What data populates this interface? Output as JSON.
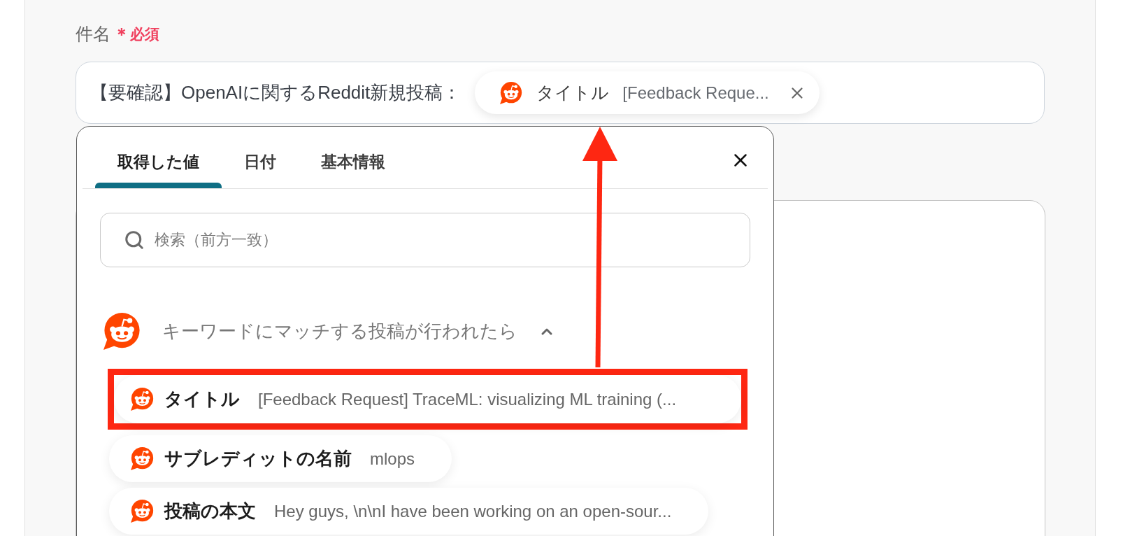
{
  "field": {
    "label": "件名",
    "required_mark": "＊",
    "required_text": "必須",
    "value": "【要確認】OpenAIに関するReddit新規投稿：",
    "chip": {
      "label": "タイトル",
      "value": "[Feedback Reque..."
    }
  },
  "picker": {
    "tabs": [
      {
        "label": "取得した値",
        "selected": true
      },
      {
        "label": "日付",
        "selected": false
      },
      {
        "label": "基本情報",
        "selected": false
      }
    ],
    "search": {
      "placeholder": "検索（前方一致）"
    },
    "group": {
      "title": "キーワードにマッチする投稿が行われたら",
      "expanded": true,
      "items": [
        {
          "label": "タイトル",
          "value": "[Feedback Request] TraceML: visualizing ML training (...",
          "highlighted": true
        },
        {
          "label": "サブレディットの名前",
          "value": "mlops",
          "highlighted": false
        },
        {
          "label": "投稿の本文",
          "value": "Hey guys, \\n\\nI have been working on an open-sour...",
          "highlighted": false
        }
      ]
    }
  }
}
